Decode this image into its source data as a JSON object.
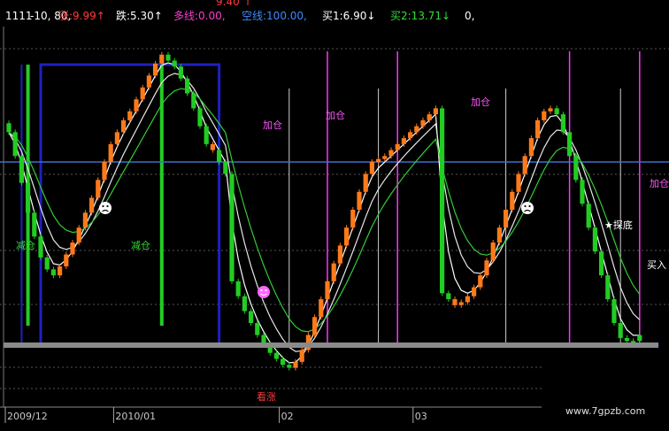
{
  "header": {
    "title": "1111",
    "params": "-10, 80,",
    "items": [
      {
        "label": "涨:",
        "value": "9.99",
        "arrow": "↑",
        "color": "#ff3b3b"
      },
      {
        "label": "跌:",
        "value": "5.30",
        "arrow": "↑",
        "color": "#ffffff"
      },
      {
        "label": "多线:",
        "value": "0.00,",
        "arrow": "",
        "color": "#ff3bd2"
      },
      {
        "label": "空线:",
        "value": "100.00,",
        "arrow": "",
        "color": "#3b8cff"
      },
      {
        "label": "买1:",
        "value": "6.90",
        "arrow": "↓",
        "color": "#ffffff"
      },
      {
        "label": "买2:",
        "value": "13.71",
        "arrow": "↓",
        "color": "#33dd33"
      },
      {
        "label": "0,",
        "value": "",
        "arrow": "",
        "color": "#ffffff"
      }
    ],
    "top_value": "9.40",
    "top_arrow": "↑"
  },
  "x_axis": {
    "ticks": [
      {
        "label": "2009/12",
        "index": 0
      },
      {
        "label": "2010/01",
        "index": 17
      },
      {
        "label": "02",
        "index": 43
      },
      {
        "label": "03",
        "index": 64
      }
    ]
  },
  "annotations": {
    "jiancang_left": "减仓",
    "jiancang_mid": "减仓",
    "jiacang_1": "加仓",
    "jiacang_2": "加仓",
    "jiacang_top": "加仓",
    "jiacang_right": "加仓",
    "kanzhang": "看涨",
    "tandi": "★探底",
    "mairu": "买入"
  },
  "watermark": "www.7gpzb.com",
  "colors": {
    "up": "#ff7a1a",
    "down": "#22cc22",
    "pink": "#ff33ff",
    "blue": "#2020c0",
    "midline": "#3b6fd0",
    "bottom": "#8a8a8a"
  },
  "chart_data": {
    "type": "candlestick",
    "title": "",
    "xlabel": "",
    "ylabel": "",
    "x_ticks": [
      "2009/12",
      "2010/01",
      "02",
      "03"
    ],
    "y_range": [
      0,
      100
    ],
    "midline": 62,
    "close": [
      72,
      64,
      55,
      45,
      37,
      30,
      26,
      24,
      27,
      31,
      35,
      40,
      45,
      50,
      56,
      62,
      68,
      72,
      76,
      79,
      83,
      87,
      91,
      95,
      98,
      96,
      94,
      90,
      85,
      80,
      74,
      68,
      66,
      62,
      58,
      22,
      17,
      12,
      8,
      4,
      1,
      -2,
      -4,
      -6,
      -7,
      -5,
      -1,
      4,
      10,
      16,
      22,
      28,
      34,
      40,
      46,
      52,
      58,
      62,
      63,
      64,
      66,
      68,
      70,
      72,
      74,
      76,
      78,
      80,
      18,
      16,
      14,
      15,
      17,
      20,
      24,
      29,
      35,
      40,
      46,
      52,
      58,
      64,
      70,
      76,
      79,
      80,
      78,
      72,
      64,
      56,
      48,
      40,
      32,
      24,
      16,
      8,
      3,
      2,
      2,
      4
    ],
    "kind": [
      "d",
      "d",
      "d",
      "d",
      "d",
      "d",
      "d",
      "d",
      "u",
      "u",
      "u",
      "u",
      "u",
      "u",
      "u",
      "u",
      "u",
      "u",
      "u",
      "u",
      "u",
      "u",
      "u",
      "u",
      "u",
      "d",
      "d",
      "d",
      "d",
      "d",
      "d",
      "d",
      "u",
      "d",
      "d",
      "d",
      "d",
      "d",
      "d",
      "d",
      "d",
      "d",
      "d",
      "d",
      "d",
      "u",
      "u",
      "u",
      "u",
      "u",
      "u",
      "u",
      "u",
      "u",
      "u",
      "u",
      "u",
      "u",
      "u",
      "u",
      "u",
      "u",
      "u",
      "u",
      "u",
      "u",
      "u",
      "u",
      "d",
      "d",
      "u",
      "u",
      "u",
      "u",
      "u",
      "u",
      "u",
      "u",
      "u",
      "u",
      "u",
      "u",
      "u",
      "u",
      "u",
      "u",
      "d",
      "d",
      "d",
      "d",
      "d",
      "d",
      "d",
      "d",
      "d",
      "d",
      "d",
      "d",
      "d",
      "d",
      "u"
    ],
    "blue_band": [
      0,
      0,
      0,
      0,
      0,
      1,
      1,
      1,
      1,
      1,
      1,
      1,
      1,
      1,
      1,
      1,
      1,
      1,
      1,
      1,
      1,
      1,
      1,
      1,
      1,
      1,
      1,
      1,
      1,
      1,
      1,
      1,
      1,
      0,
      0,
      0,
      0,
      0,
      0,
      0,
      0,
      0,
      0,
      0,
      0,
      0,
      0,
      0,
      0,
      0,
      0,
      0,
      0,
      0,
      0,
      0,
      0,
      0,
      0,
      0,
      0,
      0,
      0,
      0,
      0,
      0,
      0,
      0,
      0,
      0,
      0,
      0,
      0,
      0,
      0,
      0,
      0,
      0,
      0,
      0,
      0,
      0,
      0,
      0,
      0,
      0,
      0,
      0,
      0,
      0,
      0,
      0,
      0,
      0,
      0,
      0,
      0,
      0,
      0,
      0,
      0,
      0
    ],
    "green_markers": [
      3,
      24
    ],
    "pink_markers": [
      50,
      61,
      88,
      99
    ],
    "white_markers": [
      44,
      58,
      78,
      96
    ]
  }
}
